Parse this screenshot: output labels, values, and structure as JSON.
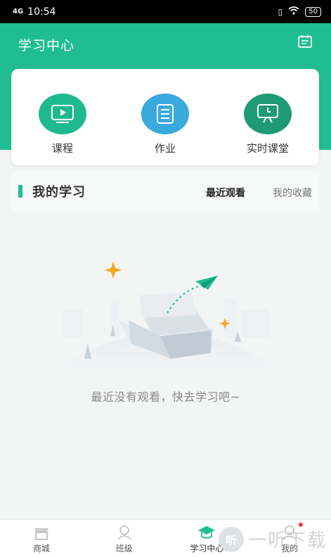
{
  "status_bar": {
    "signal": "4G",
    "time": "10:54",
    "battery": "50"
  },
  "header": {
    "title": "学习中心",
    "calendar_icon": "calendar-icon"
  },
  "quick_entries": [
    {
      "label": "课程",
      "icon": "video-icon",
      "color": "#1fb98f"
    },
    {
      "label": "作业",
      "icon": "document-icon",
      "color": "#3aa9dd"
    },
    {
      "label": "实时课堂",
      "icon": "live-class-icon",
      "color": "#1e9a74"
    }
  ],
  "my_study": {
    "title": "我的学习",
    "tabs": [
      {
        "label": "最近观看",
        "active": true
      },
      {
        "label": "我的收藏",
        "active": false
      }
    ],
    "empty_message": "最近没有观看，快去学习吧~"
  },
  "bottom_nav": [
    {
      "label": "商城",
      "icon": "store-icon",
      "active": false
    },
    {
      "label": "班级",
      "icon": "class-icon",
      "active": false
    },
    {
      "label": "学习中心",
      "icon": "graduation-cap-icon",
      "active": true
    },
    {
      "label": "我的",
      "icon": "profile-icon",
      "active": false,
      "badge": true
    }
  ],
  "watermark": {
    "logo_text": "听",
    "text": "一听下载"
  },
  "colors": {
    "primary": "#21bd92",
    "blue": "#3aa9dd",
    "accent_orange": "#f5a623",
    "badge_red": "#e53935"
  }
}
